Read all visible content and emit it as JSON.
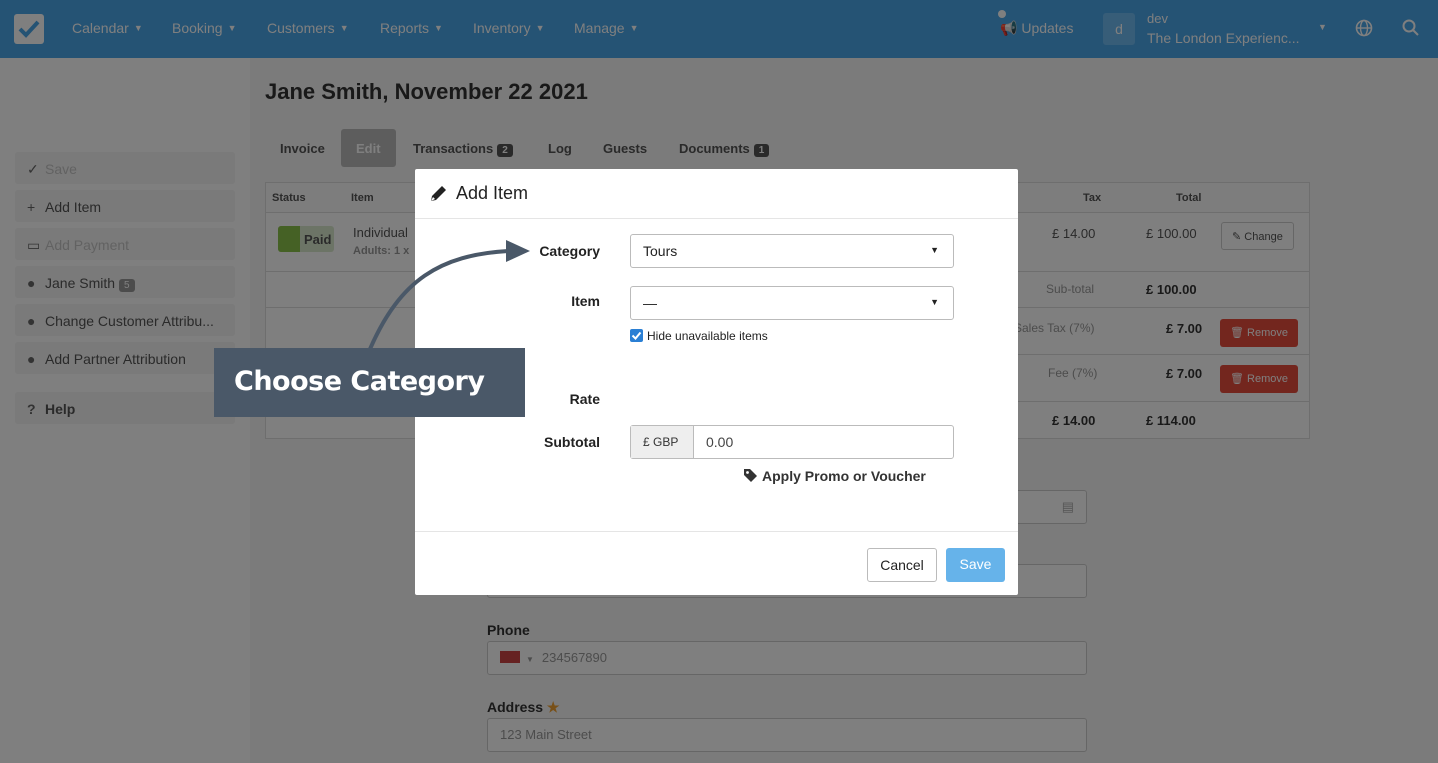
{
  "nav": {
    "items": [
      {
        "label": "Calendar"
      },
      {
        "label": "Booking"
      },
      {
        "label": "Customers"
      },
      {
        "label": "Reports"
      },
      {
        "label": "Inventory"
      },
      {
        "label": "Manage"
      }
    ],
    "updates_label": "Updates",
    "user_initial": "d",
    "user_name": "dev",
    "user_org": "The London Experienc..."
  },
  "sidebar": {
    "save": "Save",
    "add_item": "Add Item",
    "add_payment": "Add Payment",
    "customer": "Jane Smith",
    "customer_badge": "5",
    "change_attribution": "Change Customer Attribu...",
    "partner_attribution": "Add Partner Attribution",
    "help": "Help"
  },
  "page": {
    "title": "Jane Smith, November 22 2021",
    "tabs": [
      {
        "label": "Invoice"
      },
      {
        "label": "Edit"
      },
      {
        "label": "Transactions",
        "count": "2"
      },
      {
        "label": "Log"
      },
      {
        "label": "Guests"
      },
      {
        "label": "Documents",
        "count": "1"
      }
    ]
  },
  "table": {
    "headers": {
      "status": "Status",
      "item": "Item",
      "tax": "Tax",
      "total": "Total"
    },
    "row": {
      "status": "Paid",
      "item": "Individual",
      "item_sub": "Adults: 1 x",
      "tax": "£ 14.00",
      "total": "£ 100.00",
      "action": "Change"
    },
    "subtotal_label": "Sub-total",
    "subtotal_value": "£ 100.00",
    "sales_tax_label": "Sales Tax (7%)",
    "sales_tax_value": "£ 7.00",
    "fee_label": "Fee (7%)",
    "fee_value": "£ 7.00",
    "remove_label": "Remove",
    "total_tax": "£ 14.00",
    "grand_total": "£ 114.00"
  },
  "form": {
    "phone_label": "Phone",
    "phone_placeholder": "234567890",
    "address_label": "Address",
    "address_placeholder": "123 Main Street"
  },
  "modal": {
    "title": "Add Item",
    "category_label": "Category",
    "category_value": "Tours",
    "item_label": "Item",
    "item_value": "—",
    "hide_unavailable": "Hide unavailable items",
    "rate_label": "Rate",
    "subtotal_label": "Subtotal",
    "currency": "£ GBP",
    "subtotal_value": "0.00",
    "promo_link": "Apply Promo or Voucher",
    "cancel": "Cancel",
    "save": "Save"
  },
  "callout": {
    "text": "Choose Category"
  }
}
